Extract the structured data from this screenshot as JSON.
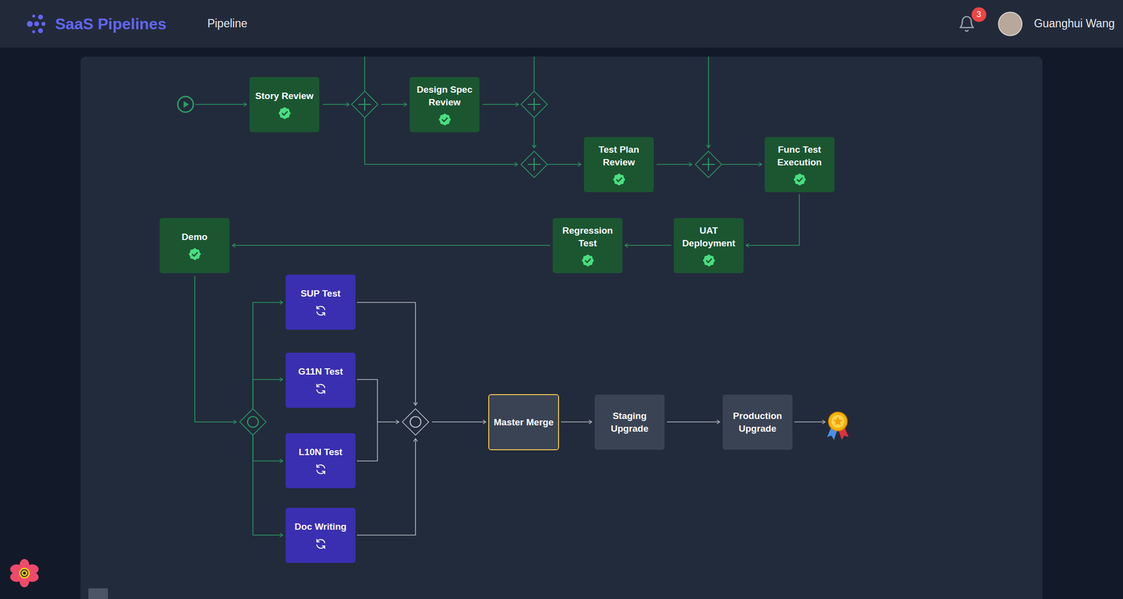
{
  "header": {
    "brand": "SaaS Pipelines",
    "nav": [
      {
        "label": "Pipeline"
      }
    ],
    "notifications": {
      "count": "3"
    },
    "user": {
      "name": "Guanghui Wang"
    }
  },
  "pipeline": {
    "start": {
      "status": "done"
    },
    "nodes": [
      {
        "label": "Story Review",
        "status": "done",
        "selected": false
      },
      {
        "label": "Design Spec Review",
        "status": "done",
        "selected": false
      },
      {
        "label": "Test Plan Review",
        "status": "done",
        "selected": false
      },
      {
        "label": "Func Test Execution",
        "status": "done",
        "selected": false
      },
      {
        "label": "UAT Deployment",
        "status": "done",
        "selected": false
      },
      {
        "label": "Regression Test",
        "status": "done",
        "selected": false
      },
      {
        "label": "Demo",
        "status": "done",
        "selected": false
      },
      {
        "label": "SUP Test",
        "status": "running",
        "selected": false
      },
      {
        "label": "G11N Test",
        "status": "running",
        "selected": false
      },
      {
        "label": "L10N Test",
        "status": "running",
        "selected": false
      },
      {
        "label": "Doc Writing",
        "status": "running",
        "selected": false
      },
      {
        "label": "Master Merge",
        "status": "pending",
        "selected": true
      },
      {
        "label": "Staging Upgrade",
        "status": "pending",
        "selected": false
      },
      {
        "label": "Production Upgrade",
        "status": "pending",
        "selected": false
      }
    ],
    "gateways": [
      {
        "kind": "parallel",
        "status": "done"
      },
      {
        "kind": "parallel",
        "status": "done"
      },
      {
        "kind": "parallel",
        "status": "done"
      },
      {
        "kind": "parallel",
        "status": "done"
      },
      {
        "kind": "inclusive",
        "status": "done"
      },
      {
        "kind": "inclusive",
        "status": "pending"
      }
    ]
  }
}
